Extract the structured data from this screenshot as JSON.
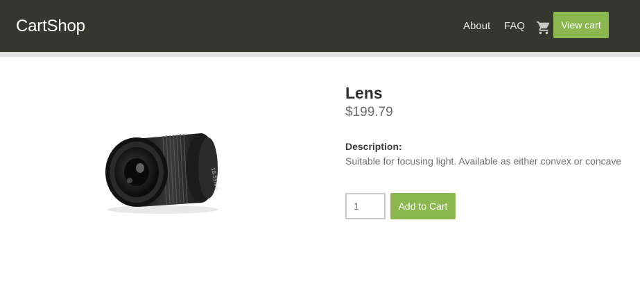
{
  "header": {
    "brand": "CartShop",
    "nav": [
      {
        "label": "About"
      },
      {
        "label": "FAQ"
      }
    ],
    "cart_icon": "shopping-cart-icon",
    "view_cart_label": "View cart"
  },
  "product": {
    "image_icon": "camera-lens-image",
    "name": "Lens",
    "price": "$199.79",
    "description_label": "Description:",
    "description": "Suitable for focusing light. Available as either convex or concave",
    "quantity": "1",
    "add_to_cart_label": "Add to Cart"
  },
  "colors": {
    "navbar": "#35372f",
    "accent": "#8bb74f"
  }
}
